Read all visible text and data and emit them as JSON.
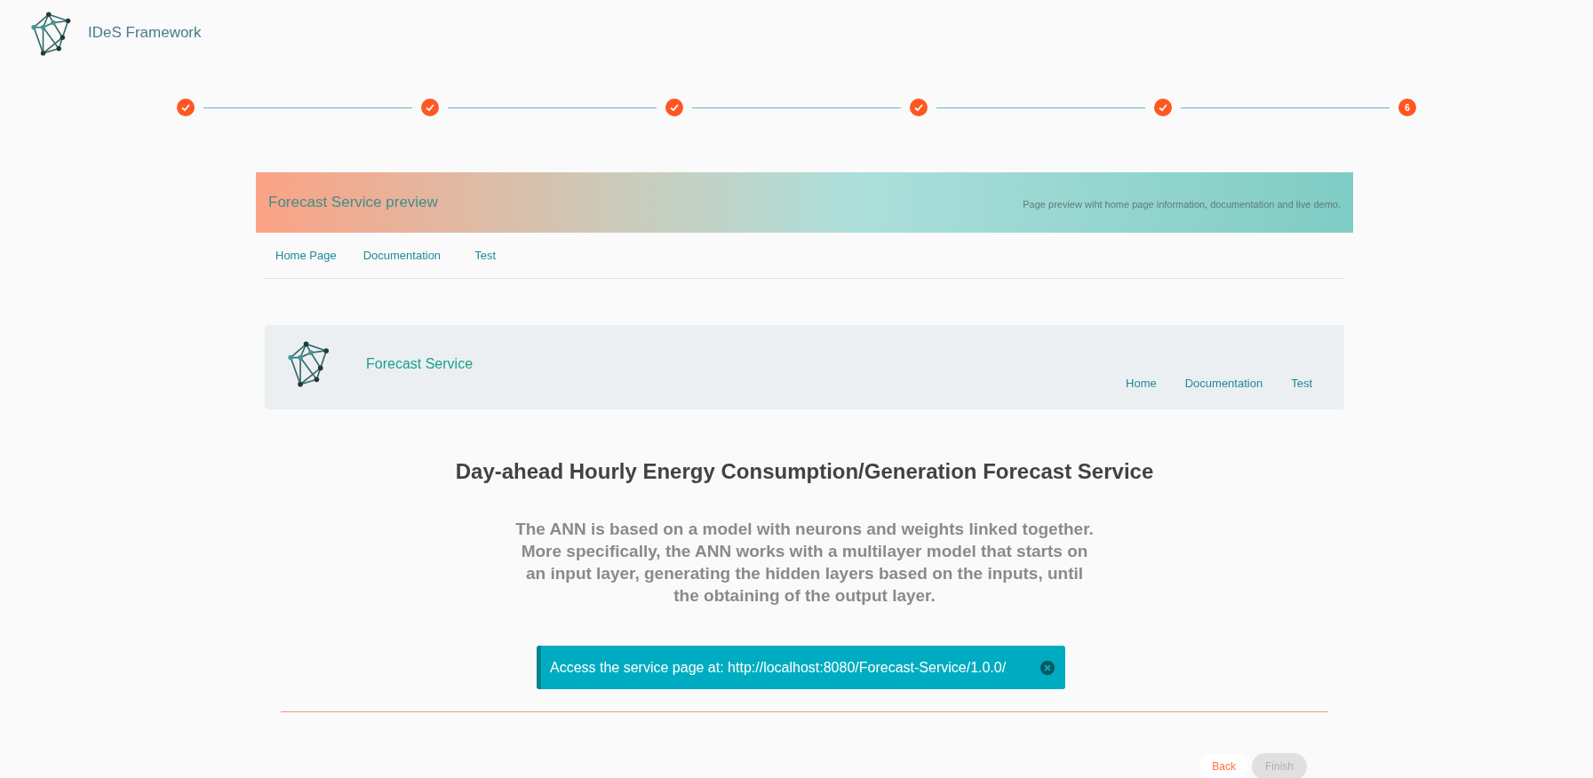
{
  "app": {
    "title": "IDeS Framework"
  },
  "steps": [
    {
      "completed": true
    },
    {
      "completed": true
    },
    {
      "completed": true
    },
    {
      "completed": true
    },
    {
      "completed": true
    },
    {
      "completed": false,
      "label": "6"
    }
  ],
  "banner": {
    "title": "Forecast Service preview",
    "subtitle": "Page preview wiht home page information, documentation and live demo."
  },
  "tabs": [
    {
      "label": "Home Page"
    },
    {
      "label": "Documentation"
    },
    {
      "label": "Test"
    }
  ],
  "preview": {
    "title": "Forecast Service",
    "nav": [
      "Home",
      "Documentation",
      "Test"
    ],
    "heading": "Day-ahead Hourly Energy Consumption/Generation Forecast Service",
    "description": "The ANN is based on a model with neurons and weights linked together. More specifically, the ANN works with a multilayer model that starts on an input layer, generating the hidden layers based on the inputs, until the obtaining of the output layer."
  },
  "alert": {
    "text": "Access the service page at: http://localhost:8080/Forecast-Service/1.0.0/"
  },
  "buttons": [
    {
      "label": "Back",
      "disabled": false
    },
    {
      "label": "Finish",
      "disabled": true
    }
  ]
}
